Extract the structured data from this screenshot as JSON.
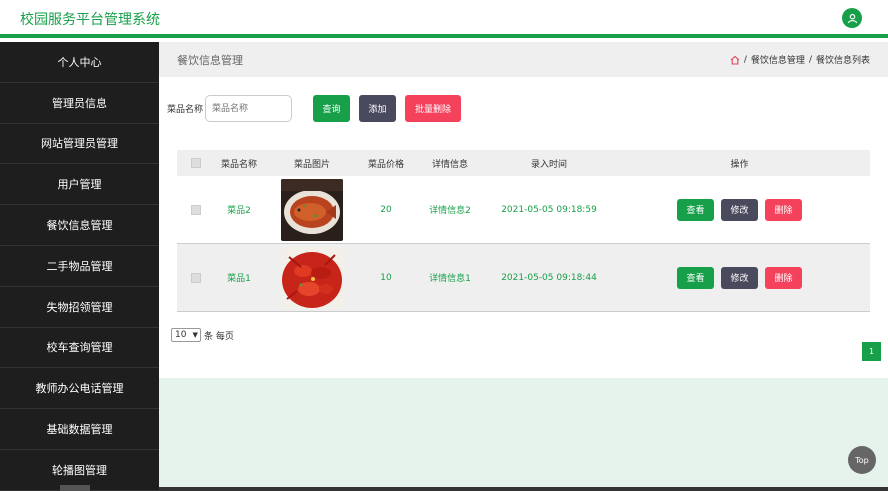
{
  "header": {
    "title": "校园服务平台管理系统",
    "avatar_icon": "user-icon",
    "accent": "#17a049"
  },
  "sidebar": {
    "items": [
      {
        "label": "个人中心"
      },
      {
        "label": "管理员信息"
      },
      {
        "label": "网站管理员管理"
      },
      {
        "label": "用户管理"
      },
      {
        "label": "餐饮信息管理"
      },
      {
        "label": "二手物品管理"
      },
      {
        "label": "失物招领管理"
      },
      {
        "label": "校车查询管理"
      },
      {
        "label": "教师办公电话管理"
      },
      {
        "label": "基础数据管理"
      },
      {
        "label": "轮播图管理"
      }
    ]
  },
  "page": {
    "title": "餐饮信息管理",
    "breadcrumb": [
      "餐饮信息管理",
      "餐饮信息列表"
    ],
    "breadcrumb_sep": "/"
  },
  "search": {
    "label": "菜品名称",
    "placeholder": "菜品名称",
    "value": ""
  },
  "toolbar": {
    "query_label": "查询",
    "add_label": "添加",
    "batch_delete_label": "批量删除"
  },
  "table": {
    "headers": [
      "菜品名称",
      "菜品图片",
      "菜品价格",
      "详情信息",
      "录入时间",
      "操作"
    ],
    "rows": [
      {
        "name": "菜品2",
        "price": "20",
        "detail": "详情信息2",
        "time": "2021-05-05 09:18:59"
      },
      {
        "name": "菜品1",
        "price": "10",
        "detail": "详情信息1",
        "time": "2021-05-05 09:18:44"
      }
    ],
    "actions": {
      "view": "查看",
      "edit": "修改",
      "delete": "删除"
    }
  },
  "pagination": {
    "page_size": "10",
    "per_page_label": "条 每页",
    "current_page": "1"
  },
  "top_button": "Top"
}
